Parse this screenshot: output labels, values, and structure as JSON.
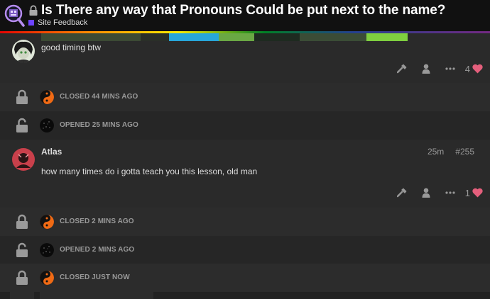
{
  "header": {
    "title": "Is There any way that Pronouns Could be put next to the name?",
    "category": "Site Feedback",
    "category_color": "#6e44ff",
    "title_icon": "lock-icon",
    "logo_icon": "forum-logo-icon"
  },
  "posts": [
    {
      "avatar_icon": "user-avatar-dark",
      "text": "good timing btw",
      "likes": "4",
      "actions": [
        "admin-wrench-icon",
        "user-icon",
        "more-icon",
        "heart-icon"
      ]
    },
    {
      "username": "Atlas",
      "time": "25m",
      "number": "#255",
      "avatar_icon": "user-avatar-red",
      "text": "how many times do i gotta teach you this lesson, old man",
      "likes": "1",
      "actions": [
        "admin-wrench-icon",
        "user-icon",
        "more-icon",
        "heart-icon"
      ]
    }
  ],
  "small_actions": [
    {
      "type": "closed",
      "text": "CLOSED 44 MINS AGO"
    },
    {
      "type": "opened",
      "text": "OPENED 25 MINS AGO"
    },
    {
      "type": "closed",
      "text": "CLOSED 2 MINS AGO"
    },
    {
      "type": "opened",
      "text": "OPENED 2 MINS AGO"
    },
    {
      "type": "closed",
      "text": "CLOSED JUST NOW"
    }
  ],
  "colors": {
    "heart": "#e45f7c",
    "muted": "#999999",
    "background": "#222222"
  }
}
